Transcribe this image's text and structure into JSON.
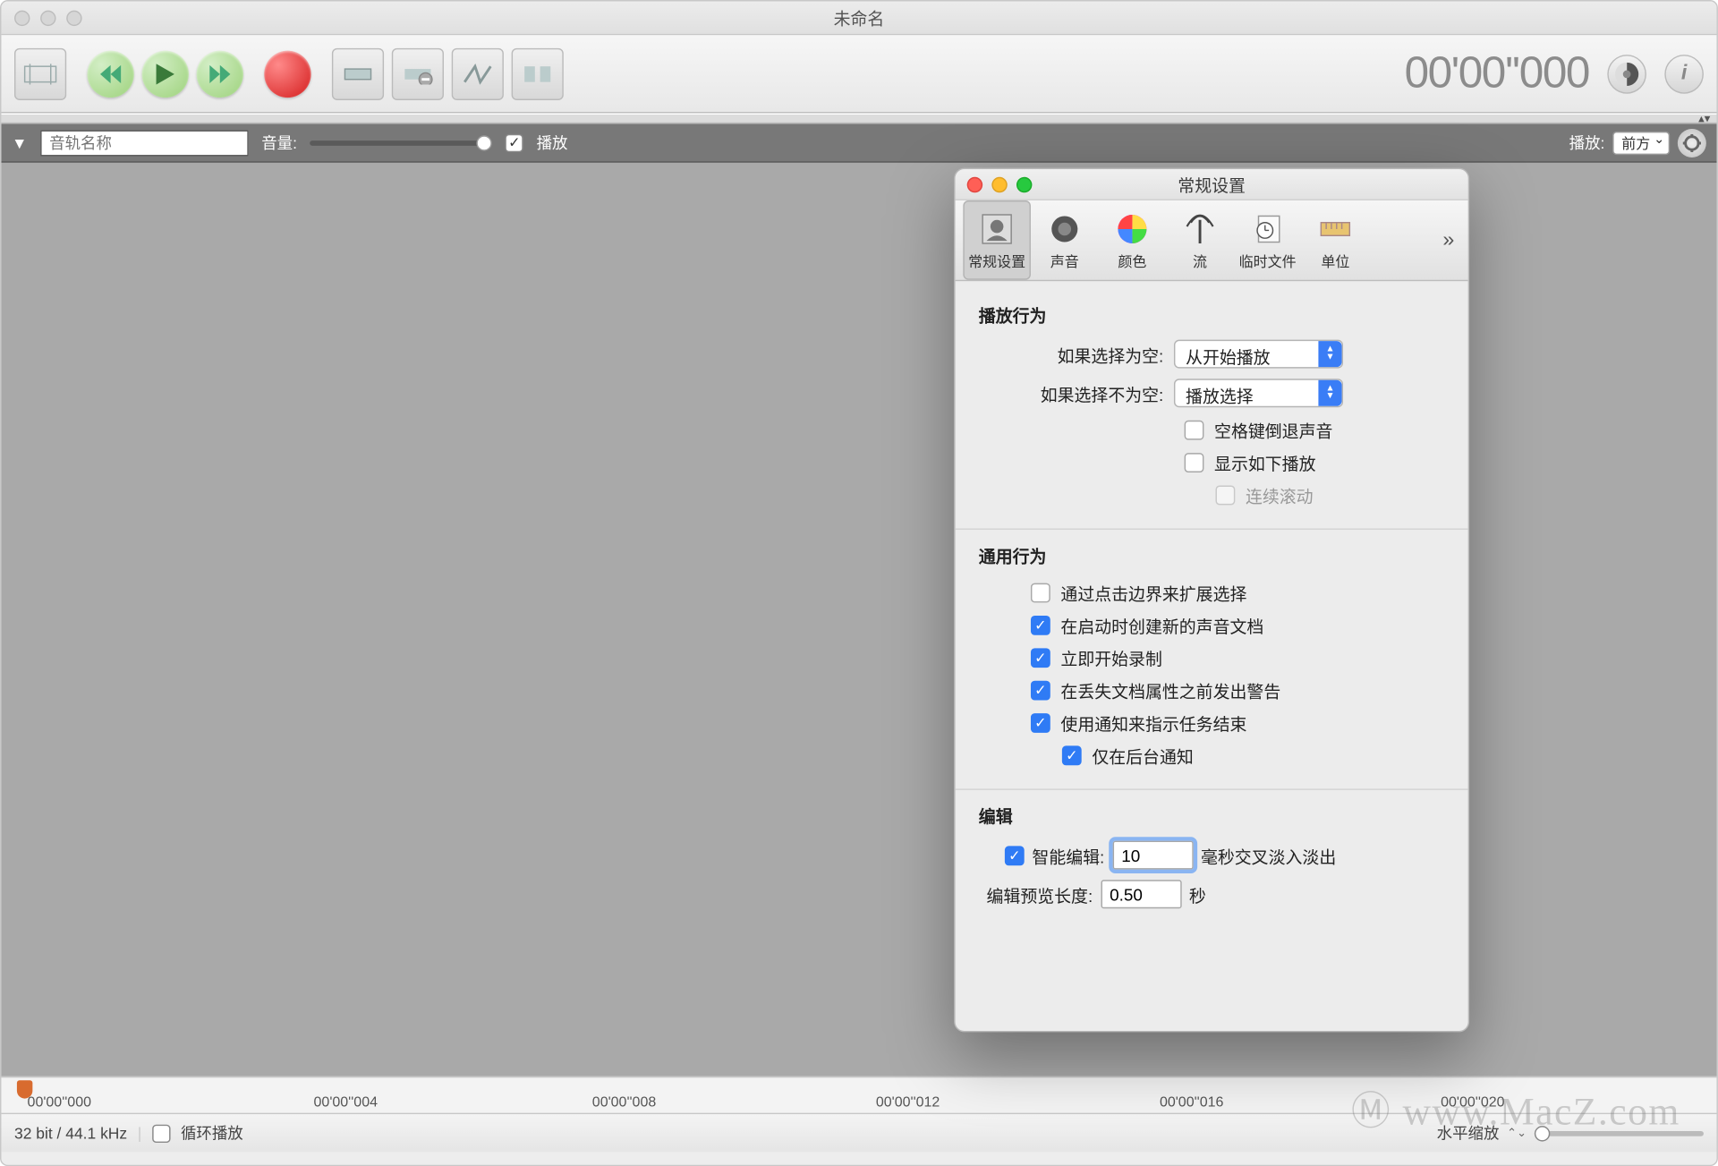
{
  "window": {
    "title": "未命名"
  },
  "toolbar": {
    "timecode": "00'00''000"
  },
  "trackbar": {
    "name_placeholder": "音轨名称",
    "volume_label": "音量:",
    "play_chk_label": "播放",
    "play_pos_label": "播放:",
    "play_pos_value": "前方"
  },
  "timeline": {
    "t0": "00'00''000",
    "t1": "00'00''004",
    "t2": "00'00''008",
    "t3": "00'00''012",
    "t4": "00'00''016",
    "t5": "00'00''020"
  },
  "status": {
    "format": "32 bit / 44.1 kHz",
    "loop_label": "循环播放",
    "zoom_label": "水平缩放"
  },
  "prefs": {
    "title": "常规设置",
    "tabs": {
      "general": "常规设置",
      "sound": "声音",
      "color": "颜色",
      "stream": "流",
      "temp": "临时文件",
      "units": "单位"
    },
    "play_behavior": {
      "heading": "播放行为",
      "if_empty_label": "如果选择为空:",
      "if_empty_value": "从开始播放",
      "if_notempty_label": "如果选择不为空:",
      "if_notempty_value": "播放选择",
      "space_rewind": "空格键倒退声音",
      "show_play": "显示如下播放",
      "cont_scroll": "连续滚动"
    },
    "general_behavior": {
      "heading": "通用行为",
      "extend_sel": "通过点击边界来扩展选择",
      "new_doc": "在启动时创建新的声音文档",
      "rec_now": "立即开始录制",
      "warn_lost": "在丢失文档属性之前发出警告",
      "notify_done": "使用通知来指示任务结束",
      "notify_bg": "仅在后台通知"
    },
    "edit": {
      "heading": "编辑",
      "smart_label": "智能编辑:",
      "smart_value": "10",
      "smart_unit": "毫秒交叉淡入淡出",
      "preview_label": "编辑预览长度:",
      "preview_value": "0.50",
      "preview_unit": "秒"
    }
  },
  "watermark": "Ⓜ www.MacZ.com"
}
